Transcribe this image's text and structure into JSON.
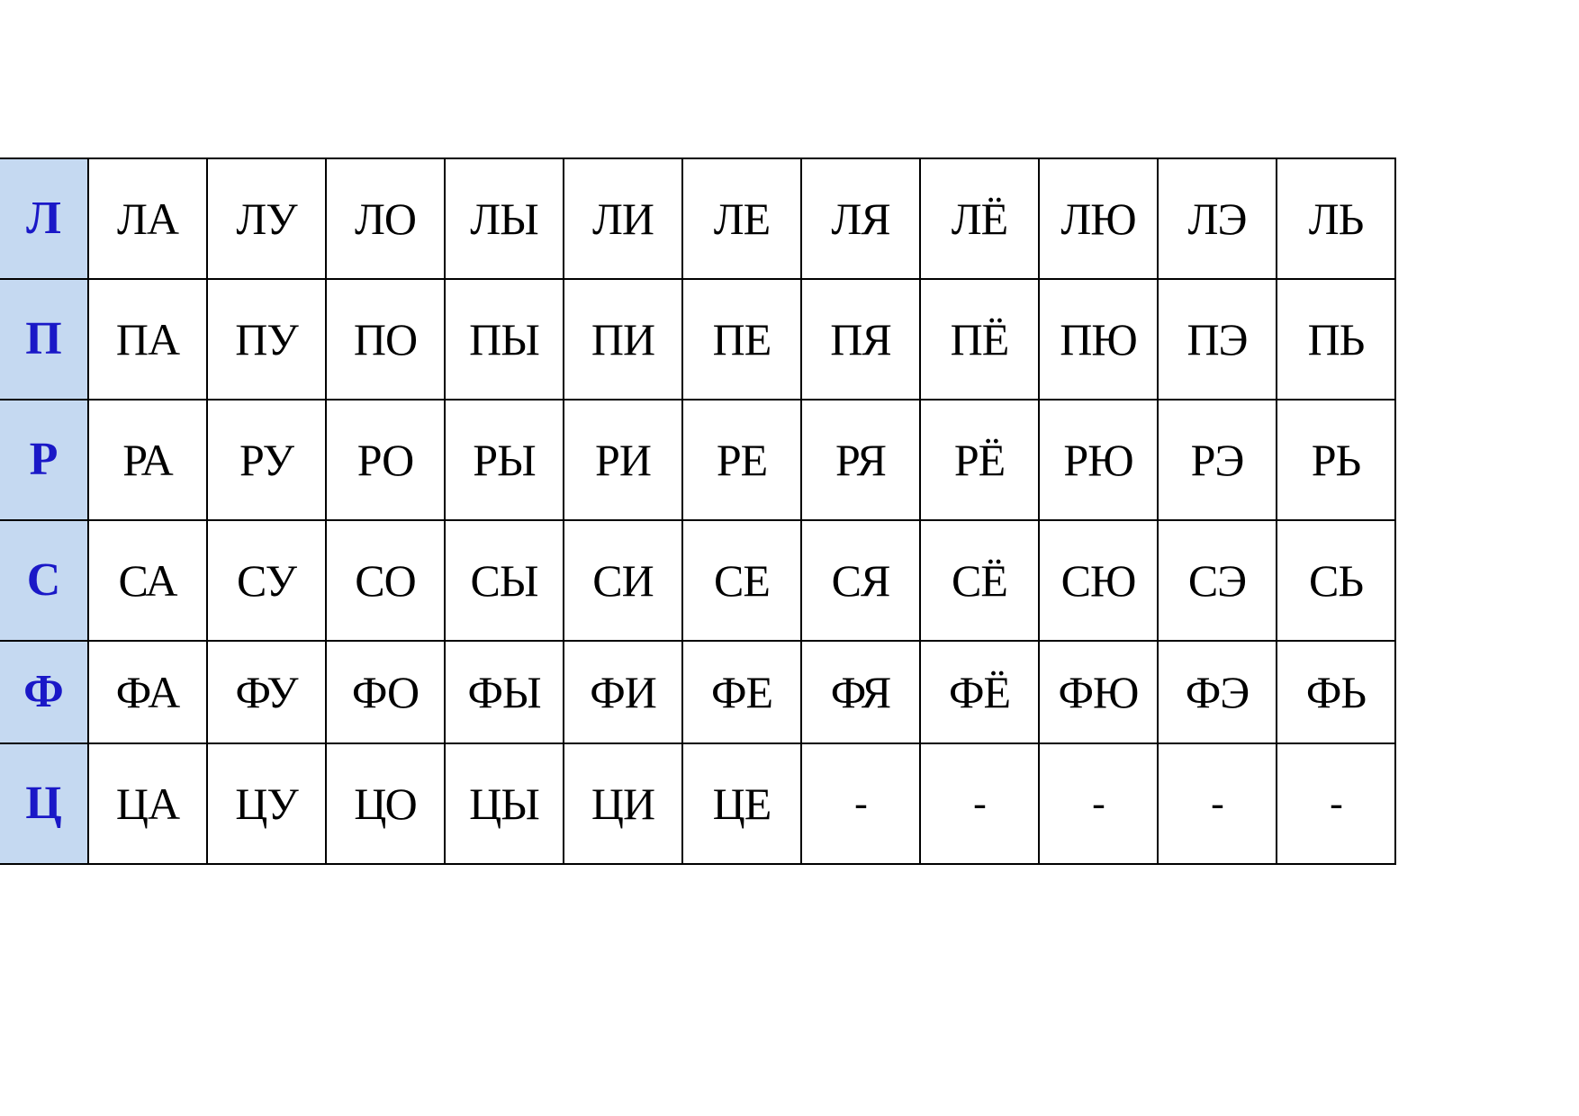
{
  "document": {
    "kind": "syllable-reading-table",
    "language": "Russian"
  },
  "colors": {
    "header_cell_background": "#c5d9f1",
    "header_letter_text": "#1a18c7",
    "cell_text": "#000000",
    "grid_line": "#000000",
    "page_background": "#ffffff"
  },
  "table": {
    "empty_marker": "-",
    "rows": [
      {
        "letter": "Л",
        "cells": [
          "ЛА",
          "ЛУ",
          "ЛО",
          "ЛЫ",
          "ЛИ",
          "ЛЕ",
          "ЛЯ",
          "ЛЁ",
          "ЛЮ",
          "ЛЭ",
          "ЛЬ"
        ]
      },
      {
        "letter": "П",
        "cells": [
          "ПА",
          "ПУ",
          "ПО",
          "ПЫ",
          "ПИ",
          "ПЕ",
          "ПЯ",
          "ПЁ",
          "ПЮ",
          "ПЭ",
          "ПЬ"
        ]
      },
      {
        "letter": "Р",
        "cells": [
          "РА",
          "РУ",
          "РО",
          "РЫ",
          "РИ",
          "РЕ",
          "РЯ",
          "РЁ",
          "РЮ",
          "РЭ",
          "РЬ"
        ]
      },
      {
        "letter": "С",
        "cells": [
          "СА",
          "СУ",
          "СО",
          "СЫ",
          "СИ",
          "СЕ",
          "СЯ",
          "СЁ",
          "СЮ",
          "СЭ",
          "СЬ"
        ]
      },
      {
        "letter": "Ф",
        "cells": [
          "ФА",
          "ФУ",
          "ФО",
          "ФЫ",
          "ФИ",
          "ФЕ",
          "ФЯ",
          "ФЁ",
          "ФЮ",
          "ФЭ",
          "ФЬ"
        ]
      },
      {
        "letter": "Ц",
        "cells": [
          "ЦА",
          "ЦУ",
          "ЦО",
          "ЦЫ",
          "ЦИ",
          "ЦЕ",
          "-",
          "-",
          "-",
          "-",
          "-"
        ]
      }
    ]
  }
}
